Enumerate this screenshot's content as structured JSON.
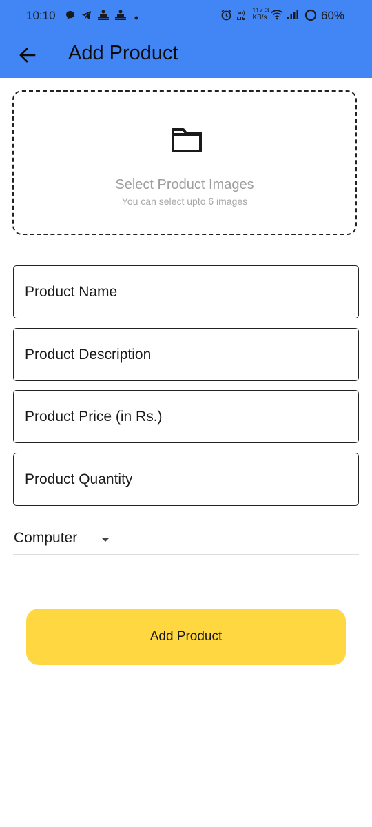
{
  "status_bar": {
    "time": "10:10",
    "speed_value": "117.3",
    "speed_unit": "KB/s",
    "battery": "60%",
    "notification_icons": [
      "chat-bubble-icon",
      "telegram-icon",
      "news-icon",
      "news-icon",
      "dot-icon"
    ],
    "system_icons": [
      "alarm-icon",
      "volte-icon",
      "wifi-icon",
      "signal-icon",
      "battery-ring-icon"
    ]
  },
  "app_bar": {
    "title": "Add Product",
    "back_icon": "arrow-back-icon",
    "color": "#4285f4"
  },
  "image_picker": {
    "icon": "folder-icon",
    "title": "Select Product Images",
    "subtitle": "You can select upto 6 images"
  },
  "fields": {
    "name_placeholder": "Product Name",
    "description_placeholder": "Product Description",
    "price_placeholder": "Product Price (in Rs.)",
    "quantity_placeholder": "Product Quantity"
  },
  "category": {
    "selected": "Computer",
    "icon": "dropdown-caret-icon"
  },
  "submit": {
    "label": "Add Product",
    "color": "#ffd740"
  }
}
